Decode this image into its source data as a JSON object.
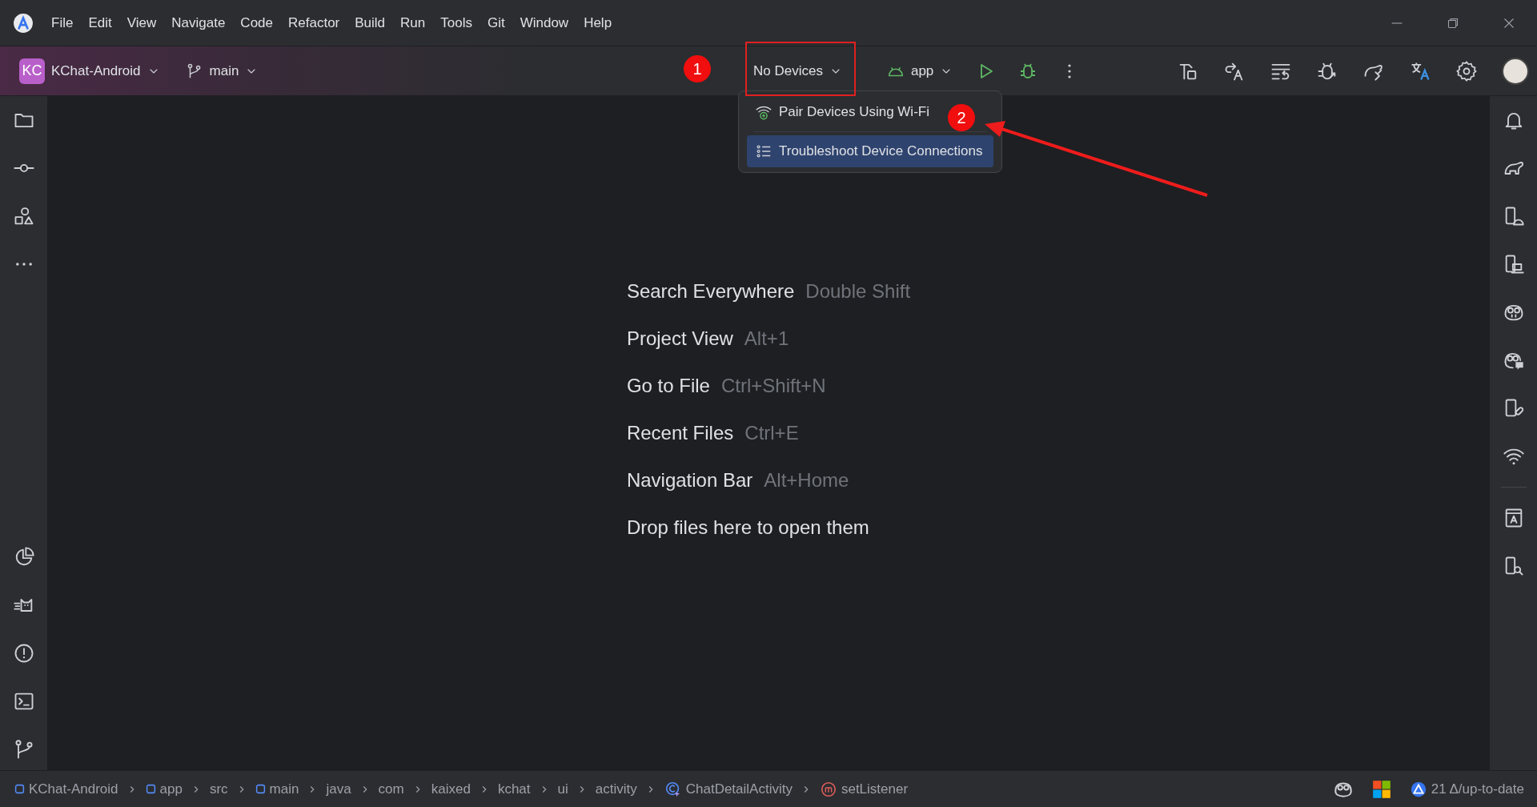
{
  "menu": [
    "File",
    "Edit",
    "View",
    "Navigate",
    "Code",
    "Refactor",
    "Build",
    "Run",
    "Tools",
    "Git",
    "Window",
    "Help"
  ],
  "toolbar": {
    "project_badge": "KC",
    "project": "KChat-Android",
    "branch": "main",
    "device_selector": "No Devices",
    "run_config": "app"
  },
  "device_menu": [
    {
      "label": "Pair Devices Using Wi-Fi",
      "kind": "wireless",
      "selected": false
    },
    {
      "label": "Troubleshoot Device Connections",
      "kind": "checklist",
      "selected": true
    }
  ],
  "annotations": [
    {
      "label": "1"
    },
    {
      "label": "2"
    }
  ],
  "welcome_hints": [
    {
      "action": "Search Everywhere",
      "shortcut": "Double Shift"
    },
    {
      "action": "Project View",
      "shortcut": "Alt+1"
    },
    {
      "action": "Go to File",
      "shortcut": "Ctrl+Shift+N"
    },
    {
      "action": "Recent Files",
      "shortcut": "Ctrl+E"
    },
    {
      "action": "Navigation Bar",
      "shortcut": "Alt+Home"
    },
    {
      "action": "Drop files here to open them"
    }
  ],
  "breadcrumbs": [
    {
      "label": "KChat-Android",
      "kind": "module"
    },
    {
      "label": "app",
      "kind": "module"
    },
    {
      "label": "src",
      "kind": "folder"
    },
    {
      "label": "main",
      "kind": "module"
    },
    {
      "label": "java",
      "kind": "folder"
    },
    {
      "label": "com",
      "kind": "folder"
    },
    {
      "label": "kaixed",
      "kind": "folder"
    },
    {
      "label": "kchat",
      "kind": "folder"
    },
    {
      "label": "ui",
      "kind": "folder"
    },
    {
      "label": "activity",
      "kind": "folder"
    },
    {
      "label": "ChatDetailActivity",
      "kind": "class"
    },
    {
      "label": "setListener",
      "kind": "method"
    }
  ],
  "status_bar": {
    "vcs_status": "21 Δ/up-to-date"
  }
}
